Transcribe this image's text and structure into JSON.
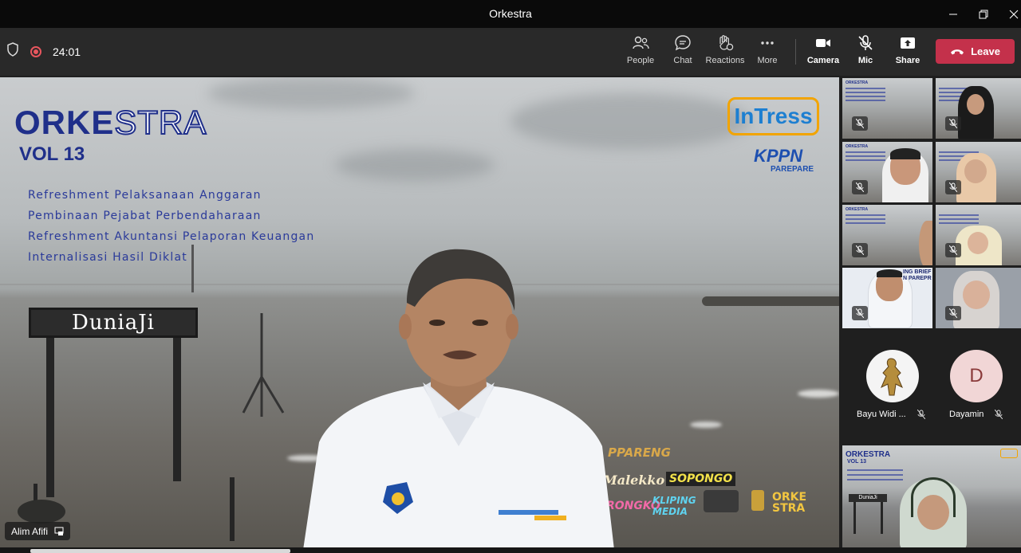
{
  "window": {
    "title": "Orkestra"
  },
  "toolbar": {
    "timer": "24:01",
    "buttons": [
      {
        "label": "People",
        "icon": "people-icon"
      },
      {
        "label": "Chat",
        "icon": "chat-icon"
      },
      {
        "label": "Reactions",
        "icon": "reactions-icon"
      },
      {
        "label": "More",
        "icon": "more-icon"
      },
      {
        "label": "Camera",
        "icon": "camera-icon"
      },
      {
        "label": "Mic",
        "icon": "mic-off-icon"
      },
      {
        "label": "Share",
        "icon": "share-icon"
      }
    ],
    "leave_label": "Leave"
  },
  "stage": {
    "presenter_name": "Alim Afifi",
    "background": {
      "title_bold": "ORKE",
      "title_light": "STRA",
      "volume": "VOL 13",
      "topics": [
        "Refreshment Pelaksanaan Anggaran",
        "Pembinaan Pejabat Perbendaharaan",
        "Refreshment Akuntansi Pelaporan Keuangan",
        "Internalisasi Hasil Diklat"
      ],
      "logo_intress": "InTress",
      "logo_kppn": "KPPN",
      "logo_kppn_city": "PAREPARE",
      "sign_text": "DuniaJi",
      "stickers": [
        "PPARENG",
        "Malekko",
        "SOPONGO",
        "RONGKO",
        "KLIPING MEDIA",
        "ORKE STRA"
      ]
    }
  },
  "gallery": {
    "mini_title": "ORKESTRA",
    "avatars": [
      {
        "name": "Bayu Widi ...",
        "initial": ""
      },
      {
        "name": "Dayamin",
        "initial": "D"
      }
    ],
    "bottom_tile": {
      "title": "ORKESTRA",
      "vol": "VOL 13",
      "sign": "DuniaJi"
    },
    "tile3_text": "ING BRIEF",
    "tile3_text2": "N PAREPR"
  },
  "colors": {
    "leave": "#c4314b",
    "record": "#e8565e",
    "brand_blue": "#1f2f8a"
  }
}
